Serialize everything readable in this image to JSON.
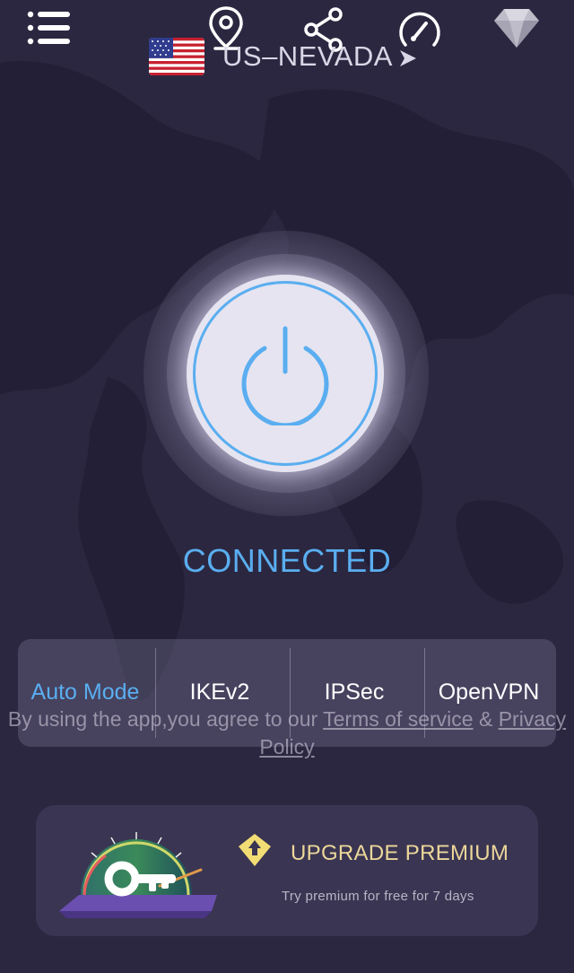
{
  "location": {
    "name": "US–NEVADA",
    "flag": "US flag"
  },
  "header_icons": [
    "menu-icon",
    "location-pin-icon",
    "share-icon",
    "speedometer-icon",
    "diamond-icon"
  ],
  "status": "CONNECTED",
  "protocols": [
    {
      "label": "Auto Mode",
      "active": true
    },
    {
      "label": "IKEv2",
      "active": false
    },
    {
      "label": "IPSec",
      "active": false
    },
    {
      "label": "OpenVPN",
      "active": false
    }
  ],
  "terms": {
    "prefix": "By using the app,you agree to our ",
    "terms_link": "Terms of service",
    "joiner": " & ",
    "privacy_link": "Privacy Policy"
  },
  "premium": {
    "title": "UPGRADE PREMIUM",
    "subtitle": "Try premium for free for 7 days"
  },
  "colors": {
    "background": "#2b2740",
    "accent_blue": "#5aaef0",
    "premium_gold": "#ecd79a",
    "card": "#3a3552"
  }
}
